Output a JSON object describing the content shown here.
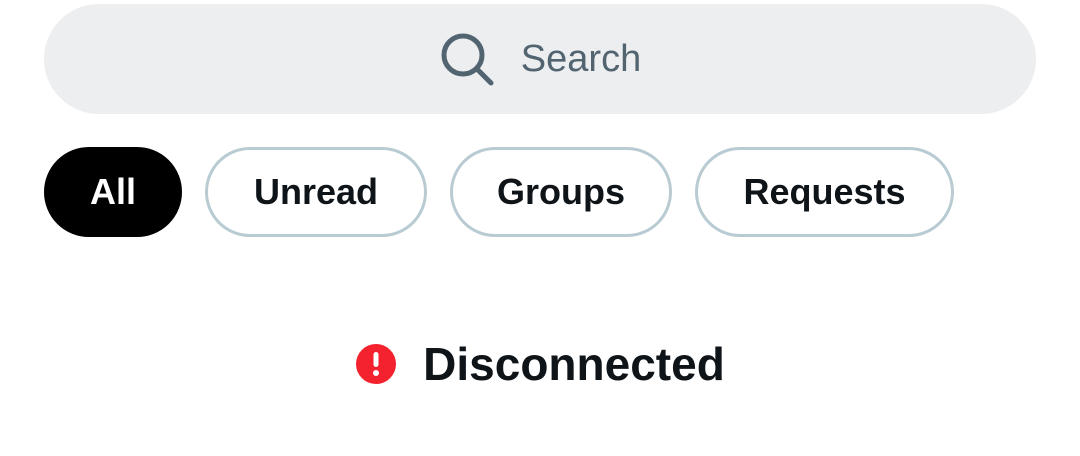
{
  "search": {
    "placeholder": "Search",
    "icon": "search-icon"
  },
  "filters": {
    "items": [
      {
        "label": "All",
        "active": true
      },
      {
        "label": "Unread",
        "active": false
      },
      {
        "label": "Groups",
        "active": false
      },
      {
        "label": "Requests",
        "active": false
      }
    ]
  },
  "status": {
    "text": "Disconnected",
    "icon": "alert-icon",
    "color": "#f4212e"
  },
  "colors": {
    "search_bg": "#eceef0",
    "chip_border": "#b9cbd2",
    "active_chip_bg": "#000000",
    "text_primary": "#0f1419",
    "text_secondary": "#536471"
  }
}
